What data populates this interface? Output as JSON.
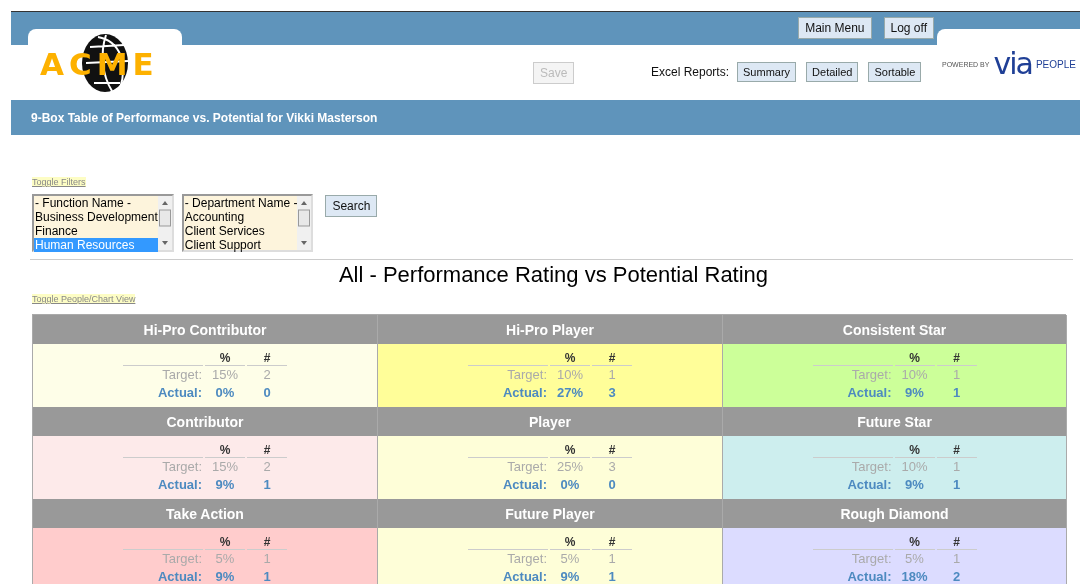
{
  "header": {
    "nav_buttons": [
      "Main Menu",
      "Log off"
    ],
    "logo": "ACME",
    "save_button": {
      "label": "Save",
      "disabled": true
    },
    "excel_label": "Excel Reports:",
    "excel_buttons": [
      "Summary",
      "Detailed",
      "Sortable"
    ],
    "powered_by": "POWERED BY",
    "brand": "via",
    "brand_suffix": "PEOPLE"
  },
  "title_bar": "9-Box Table of Performance vs. Potential for Vikki Masterson",
  "filters": {
    "toggle_link": "Toggle Filters",
    "lists": [
      {
        "items": [
          {
            "label": "- Function Name -",
            "selected": false
          },
          {
            "label": "Business Development",
            "selected": false
          },
          {
            "label": "Finance",
            "selected": false
          },
          {
            "label": "Human Resources",
            "selected": true
          }
        ]
      },
      {
        "items": [
          {
            "label": "- Department Name -",
            "selected": false
          },
          {
            "label": "Accounting",
            "selected": false
          },
          {
            "label": "Client Services",
            "selected": false
          },
          {
            "label": "Client Support",
            "selected": false
          }
        ]
      }
    ],
    "search_button": "Search"
  },
  "chart_title": "All - Performance Rating vs Potential Rating",
  "view_toggle": "Toggle People/Chart View",
  "boxes": [
    {
      "title": "Hi-Pro Contributor",
      "color": "#fefee8",
      "columns": [
        "%",
        "#"
      ],
      "rows": [
        {
          "kind": "target",
          "label": "Target:",
          "percent": "15%",
          "count": "2"
        },
        {
          "kind": "actual",
          "label": "Actual:",
          "percent": "0%",
          "count": "0"
        }
      ]
    },
    {
      "title": "Hi-Pro Player",
      "color": "#fffe99",
      "columns": [
        "%",
        "#"
      ],
      "rows": [
        {
          "kind": "target",
          "label": "Target:",
          "percent": "10%",
          "count": "1"
        },
        {
          "kind": "actual",
          "label": "Actual:",
          "percent": "27%",
          "count": "3"
        }
      ]
    },
    {
      "title": "Consistent Star",
      "color": "#ccff99",
      "columns": [
        "%",
        "#"
      ],
      "rows": [
        {
          "kind": "target",
          "label": "Target:",
          "percent": "10%",
          "count": "1"
        },
        {
          "kind": "actual",
          "label": "Actual:",
          "percent": "9%",
          "count": "1"
        }
      ]
    },
    {
      "title": "Contributor",
      "color": "#fdeaea",
      "columns": [
        "%",
        "#"
      ],
      "rows": [
        {
          "kind": "target",
          "label": "Target:",
          "percent": "15%",
          "count": "2"
        },
        {
          "kind": "actual",
          "label": "Actual:",
          "percent": "9%",
          "count": "1"
        }
      ]
    },
    {
      "title": "Player",
      "color": "#fefed8",
      "columns": [
        "%",
        "#"
      ],
      "rows": [
        {
          "kind": "target",
          "label": "Target:",
          "percent": "25%",
          "count": "3"
        },
        {
          "kind": "actual",
          "label": "Actual:",
          "percent": "0%",
          "count": "0"
        }
      ]
    },
    {
      "title": "Future Star",
      "color": "#cdeeee",
      "columns": [
        "%",
        "#"
      ],
      "rows": [
        {
          "kind": "target",
          "label": "Target:",
          "percent": "10%",
          "count": "1"
        },
        {
          "kind": "actual",
          "label": "Actual:",
          "percent": "9%",
          "count": "1"
        }
      ]
    },
    {
      "title": "Take Action",
      "color": "#ffcccc",
      "columns": [
        "%",
        "#"
      ],
      "rows": [
        {
          "kind": "target",
          "label": "Target:",
          "percent": "5%",
          "count": "1"
        },
        {
          "kind": "actual",
          "label": "Actual:",
          "percent": "9%",
          "count": "1"
        }
      ]
    },
    {
      "title": "Future Player",
      "color": "#fefed8",
      "columns": [
        "%",
        "#"
      ],
      "rows": [
        {
          "kind": "target",
          "label": "Target:",
          "percent": "5%",
          "count": "1"
        },
        {
          "kind": "actual",
          "label": "Actual:",
          "percent": "9%",
          "count": "1"
        }
      ]
    },
    {
      "title": "Rough Diamond",
      "color": "#dcdcff",
      "columns": [
        "%",
        "#"
      ],
      "rows": [
        {
          "kind": "target",
          "label": "Target:",
          "percent": "5%",
          "count": "1"
        },
        {
          "kind": "actual",
          "label": "Actual:",
          "percent": "18%",
          "count": "2"
        }
      ]
    }
  ]
}
